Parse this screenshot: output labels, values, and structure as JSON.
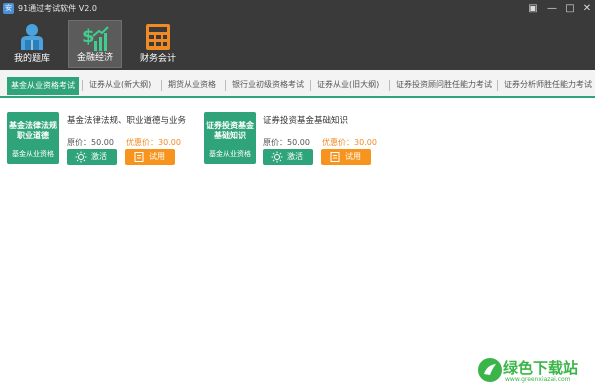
{
  "app": {
    "title": "91通过考试软件 V2.0",
    "icon_glyph": "安"
  },
  "window_controls": [
    {
      "name": "skin-icon",
      "glyph": "▣"
    },
    {
      "name": "minimize-icon",
      "glyph": "—"
    },
    {
      "name": "maximize-icon",
      "glyph": "□"
    },
    {
      "name": "close-icon",
      "glyph": "✕"
    }
  ],
  "toolbar": {
    "items": [
      {
        "label": "我的题库",
        "icon": "user-reading-icon",
        "active": false
      },
      {
        "label": "金融经济",
        "icon": "money-chart-icon",
        "active": true
      },
      {
        "label": "财务会计",
        "icon": "calculator-icon",
        "active": false
      }
    ]
  },
  "tabs": [
    {
      "label": "基金从业资格考试",
      "active": true
    },
    {
      "label": "证券从业(新大纲)",
      "active": false
    },
    {
      "label": "期货从业资格",
      "active": false
    },
    {
      "label": "银行业初级资格考试",
      "active": false
    },
    {
      "label": "证券从业(旧大纲)",
      "active": false
    },
    {
      "label": "证券投资顾问胜任能力考试",
      "active": false
    },
    {
      "label": "证券分析师胜任能力考试",
      "active": false
    }
  ],
  "courses": [
    {
      "tile_name": "基金法律法规职业道德",
      "tile_category": "基金从业资格",
      "title": "基金法律法规、职业道德与业务",
      "orig_label": "原价：",
      "orig_price": "50.00",
      "disc_label": "优惠价：",
      "disc_price": "30.00",
      "activate_label": "激活",
      "trial_label": "试用"
    },
    {
      "tile_name": "证券投资基金基础知识",
      "tile_category": "基金从业资格",
      "title": "证券投资基金基础知识",
      "orig_label": "原价：",
      "orig_price": "50.00",
      "disc_label": "优惠价：",
      "disc_price": "30.00",
      "activate_label": "激活",
      "trial_label": "试用"
    }
  ],
  "watermark": {
    "text": "绿色下载站",
    "url": "www.greenxiazai.com"
  },
  "colors": {
    "header": "#3a3a3a",
    "accent_green": "#2fa37a",
    "accent_orange": "#f7941d"
  }
}
